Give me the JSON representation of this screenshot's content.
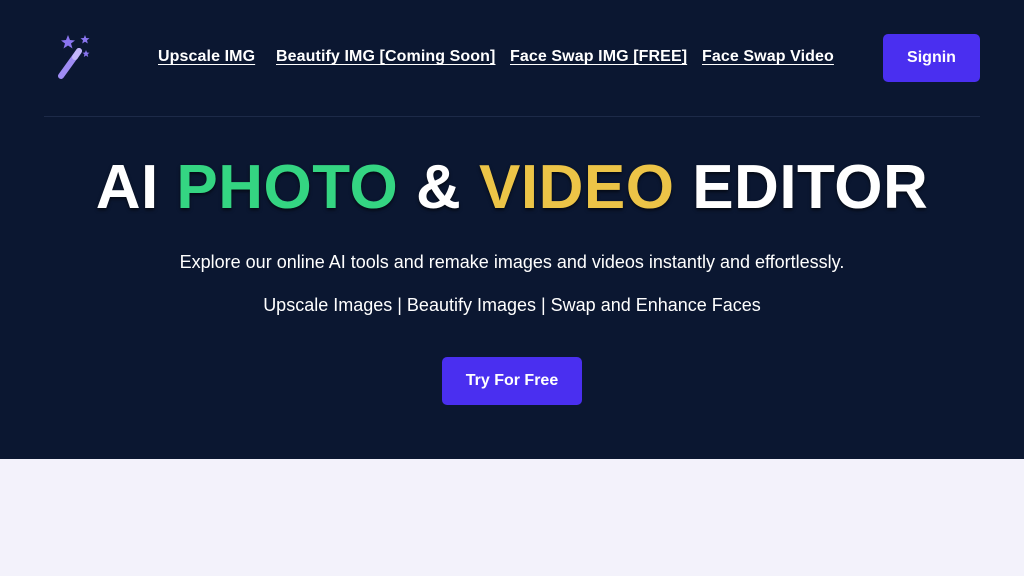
{
  "header": {
    "logo_icon": "magic-wand-icon",
    "nav": [
      {
        "label": "Upscale IMG"
      },
      {
        "label": "Beautify IMG [Coming Soon]"
      },
      {
        "label": "Face Swap IMG [FREE]"
      },
      {
        "label": "Face Swap Video"
      }
    ],
    "signin_label": "Signin"
  },
  "hero": {
    "headline": {
      "part1": "AI",
      "part2": "PHOTO",
      "part3": "&",
      "part4": "VIDEO",
      "part5": "EDITOR"
    },
    "subtitle": "Explore our online AI tools and remake images and videos instantly and effortlessly.",
    "features": "Upscale Images | Beautify Images | Swap and Enhance Faces",
    "cta_label": "Try For Free"
  },
  "colors": {
    "hero_background": "#0b1731",
    "accent_button": "#4a2ff0",
    "headline_green": "#34d582",
    "headline_yellow": "#ecc447",
    "lower_background": "#f3f2fb"
  }
}
